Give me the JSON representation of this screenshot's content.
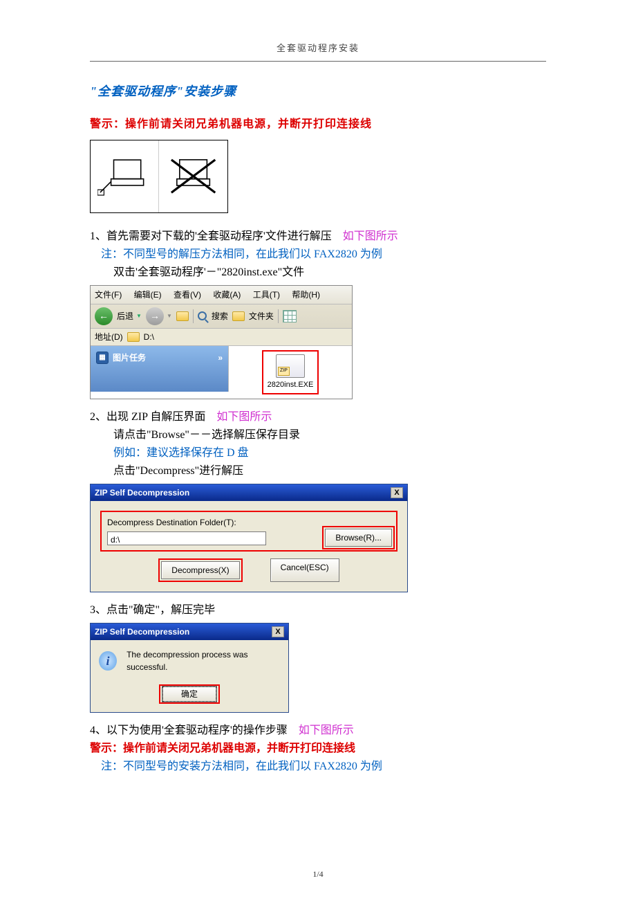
{
  "header": {
    "title": "全套驱动程序安装"
  },
  "title": "\"全套驱动程序\"安装步骤",
  "warning": "警示：操作前请关闭兄弟机器电源，并断开打印连接线",
  "step1": {
    "line1a": "1、首先需要对下载的'全套驱动程序'文件进行解压",
    "line1b": "如下图所示",
    "note": "注：不同型号的解压方法相同，在此我们以 FAX2820 为例",
    "line2": "双击'全套驱动程序'－\"2820inst.exe\"文件"
  },
  "explorer": {
    "menu": {
      "file": "文件(F)",
      "edit": "编辑(E)",
      "view": "查看(V)",
      "fav": "收藏(A)",
      "tools": "工具(T)",
      "help": "帮助(H)"
    },
    "toolbar": {
      "back": "后退",
      "search": "搜索",
      "folders": "文件夹"
    },
    "addr_label": "地址(D)",
    "addr_value": "D:\\",
    "side_title": "图片任务",
    "side_chevron": "»",
    "file_name": "2820inst.EXE"
  },
  "step2": {
    "line1a": "2、出现 ZIP 自解压界面",
    "line1b": "如下图所示",
    "line2": "请点击\"Browse\"－－选择解压保存目录",
    "note": "例如：建议选择保存在 D 盘",
    "line3": "点击\"Decompress\"进行解压"
  },
  "dlg1": {
    "title": "ZIP Self Decompression",
    "field_label": "Decompress Destination Folder(T):",
    "field_value": "d:\\",
    "browse": "Browse(R)...",
    "decompress": "Decompress(X)",
    "cancel": "Cancel(ESC)"
  },
  "step3": {
    "line": "3、点击\"确定\"，解压完毕"
  },
  "dlg2": {
    "title": "ZIP Self Decompression",
    "msg": "The decompression process was successful.",
    "ok": "确定"
  },
  "step4": {
    "line1a": "4、以下为使用'全套驱动程序'的操作步骤",
    "line1b": "如下图所示",
    "warning": "警示：操作前请关闭兄弟机器电源，并断开打印连接线",
    "note": "注：不同型号的安装方法相同，在此我们以 FAX2820 为例"
  },
  "footer": {
    "page": "1/4"
  },
  "x": "X"
}
